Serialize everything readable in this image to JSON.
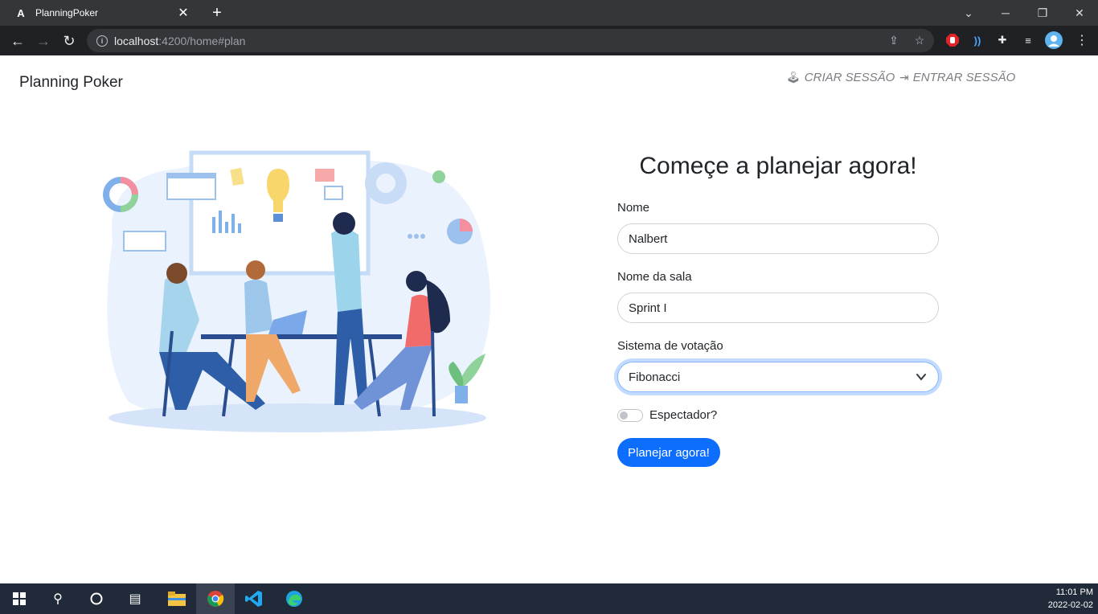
{
  "browser": {
    "tab_title": "PlanningPoker",
    "tab_favicon": "A",
    "url_host": "localhost",
    "url_rest": ":4200/home#plan"
  },
  "page": {
    "brand": "Planning Poker",
    "nav": [
      {
        "label": "CRIAR SESSÃO",
        "icon": "joystick-icon"
      },
      {
        "label": "ENTRAR SESSÃO",
        "icon": "login-icon"
      }
    ],
    "heading": "Começe a planejar agora!",
    "form": {
      "name_label": "Nome",
      "name_value": "Nalbert",
      "room_label": "Nome da sala",
      "room_value": "Sprint I",
      "system_label": "Sistema de votação",
      "system_value": "Fibonacci",
      "spectator_label": "Espectador?",
      "spectator_checked": false,
      "submit_label": "Planejar agora!"
    }
  },
  "taskbar": {
    "time": "11:01 PM",
    "date": "2022-02-02"
  },
  "colors": {
    "primary": "#0d6efd",
    "chrome_dark": "#202124",
    "taskbar": "#202a38"
  }
}
